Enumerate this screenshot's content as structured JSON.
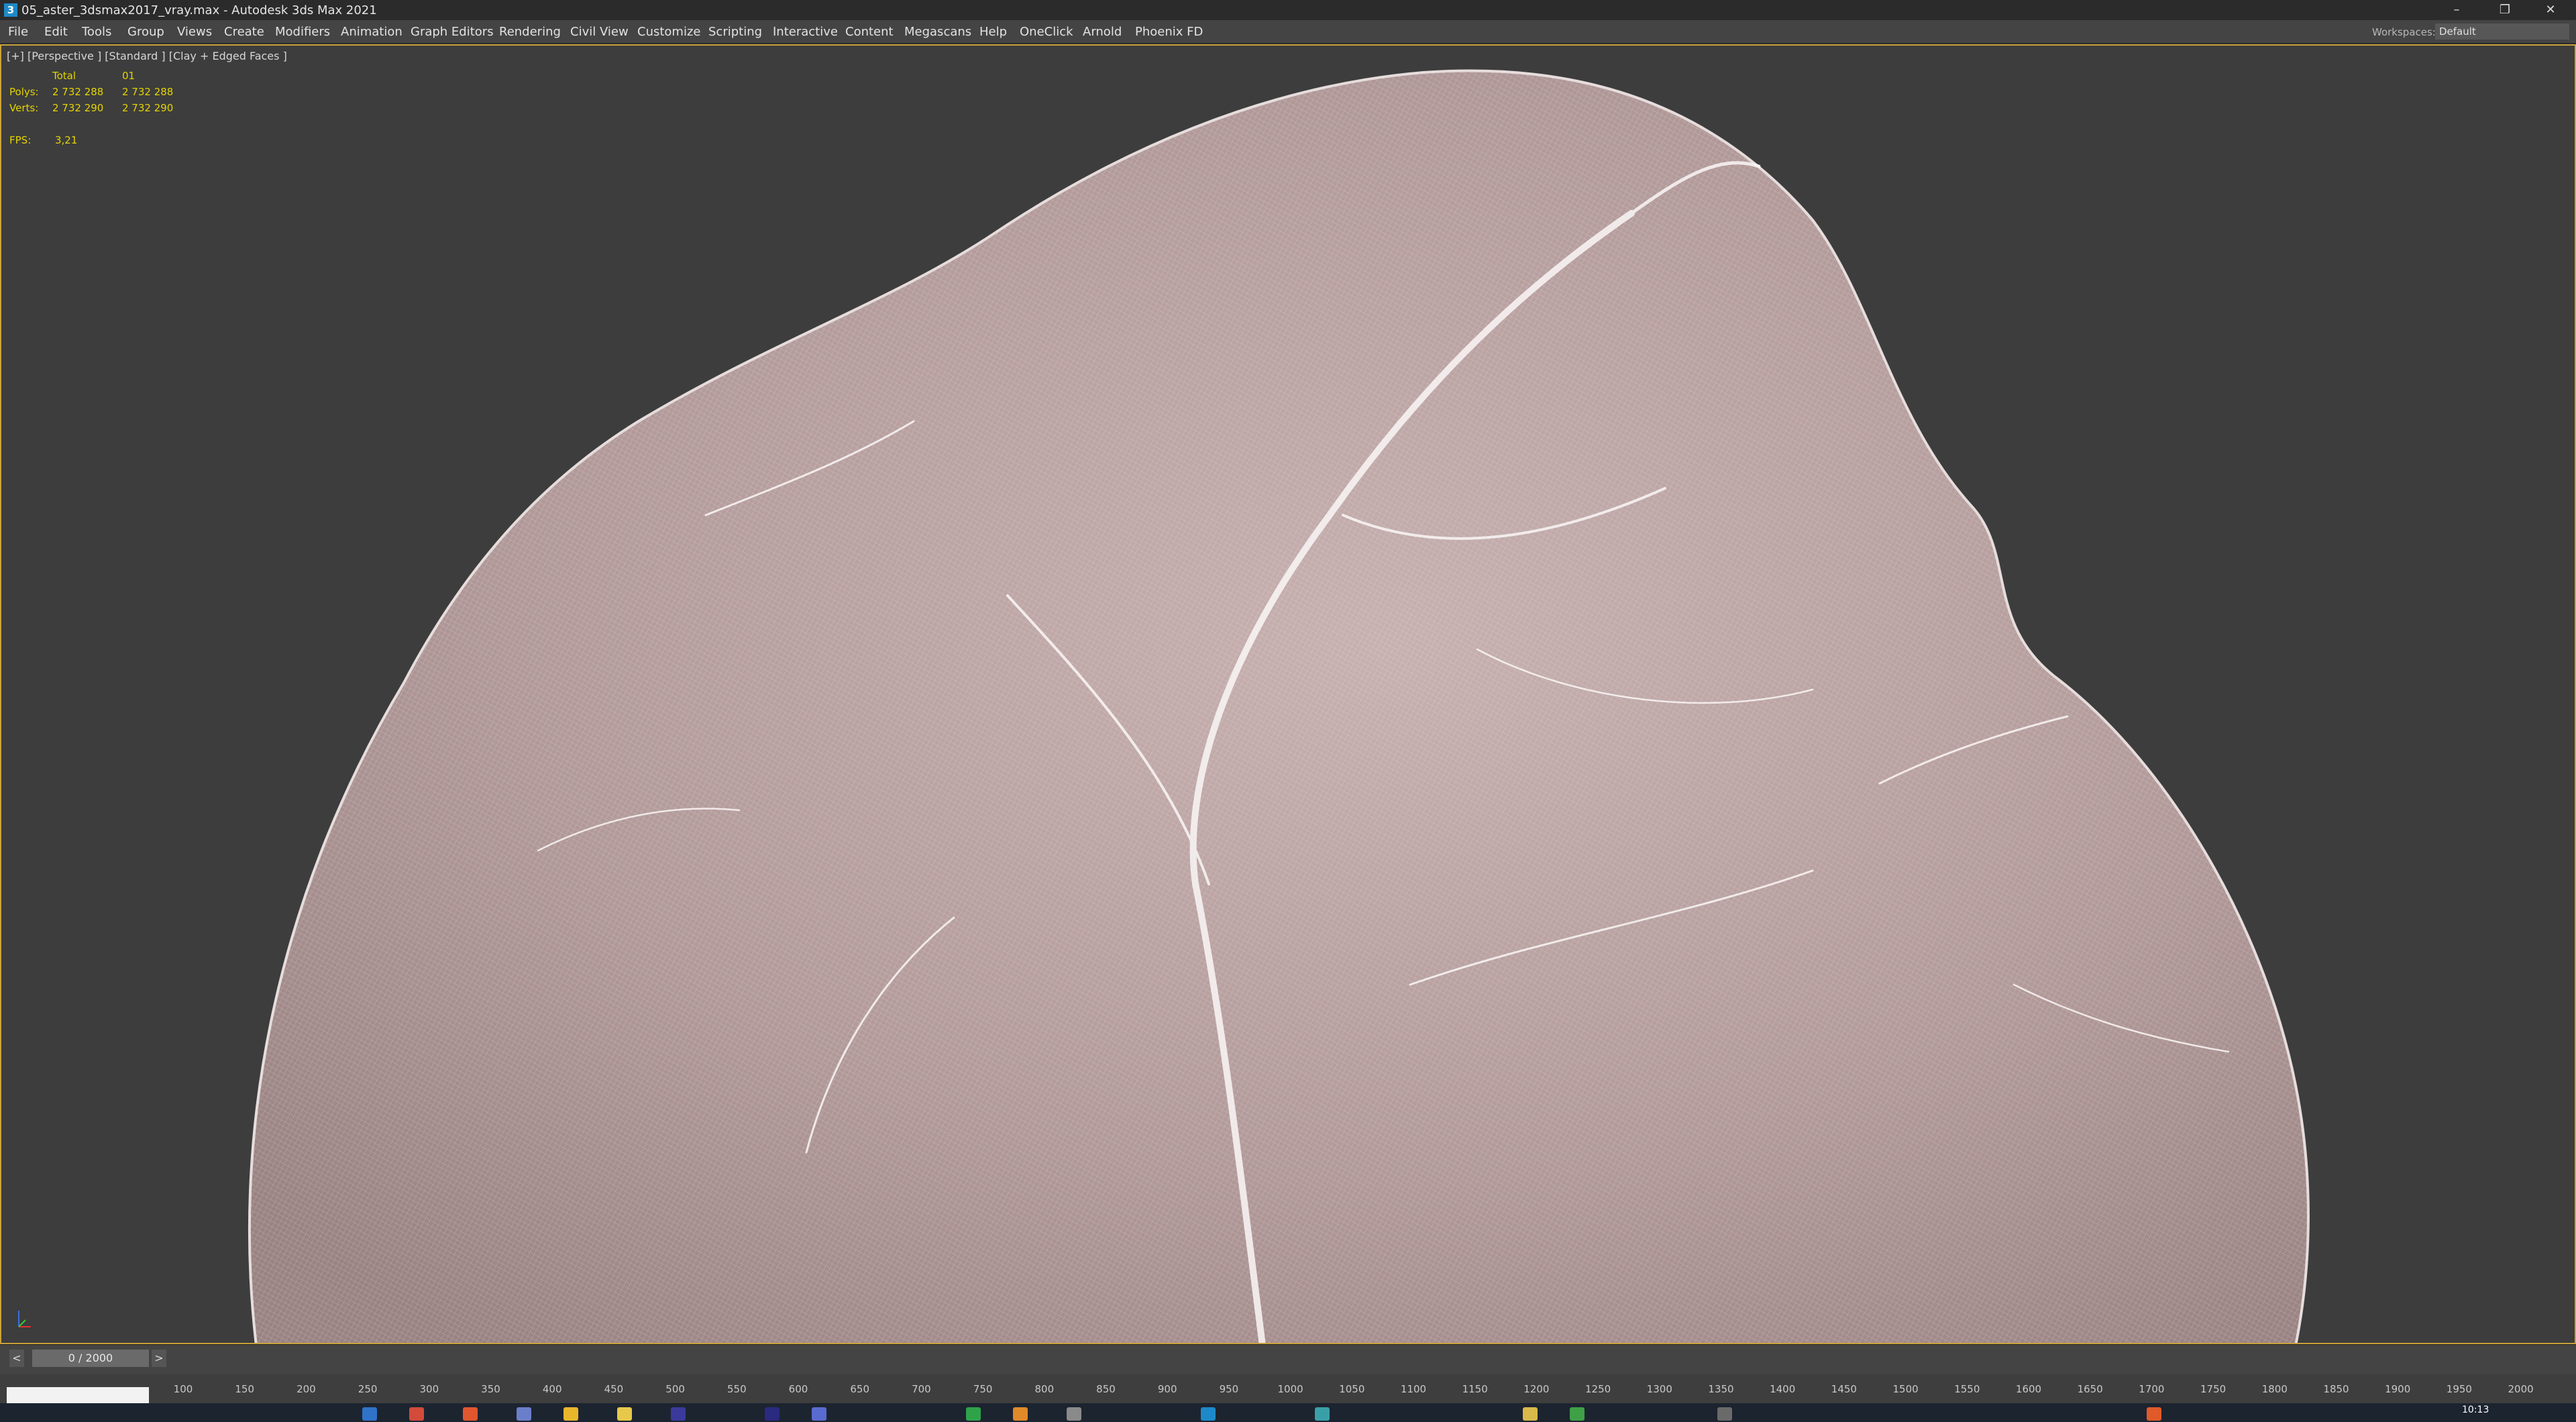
{
  "window": {
    "title": "05_aster_3dsmax2017_vray.max - Autodesk 3ds Max 2021",
    "icon_letter": "3",
    "controls": [
      "–",
      "❐",
      "✕"
    ]
  },
  "menu": {
    "items": [
      "File",
      "Edit",
      "Tools",
      "Group",
      "Views",
      "Create",
      "Modifiers",
      "Animation",
      "Graph Editors",
      "Rendering",
      "Civil View",
      "Customize",
      "Scripting",
      "Interactive",
      "Content",
      "Megascans",
      "Help",
      "OneClick",
      "Arnold",
      "Phoenix FD"
    ],
    "workspaces_label": "Workspaces:",
    "workspaces_value": "Default"
  },
  "viewport": {
    "label": "[+] [Perspective ] [Standard ] [Clay + Edged Faces ]",
    "stats": {
      "total_header": "Total",
      "object_header": "01",
      "polys_label": "Polys:",
      "polys_total": "2 732 288",
      "polys_obj": "2 732 288",
      "verts_label": "Verts:",
      "verts_total": "2 732 290",
      "verts_obj": "2 732 290",
      "fps_label": "FPS:",
      "fps_value": "3,21"
    }
  },
  "timeslider": {
    "prev": "<",
    "next": ">",
    "frame_display": "0 / 2000"
  },
  "ruler": {
    "ticks": [
      "100",
      "150",
      "200",
      "250",
      "300",
      "350",
      "400",
      "450",
      "500",
      "550",
      "600",
      "650",
      "700",
      "750",
      "800",
      "850",
      "900",
      "950",
      "1000",
      "1050",
      "1100",
      "1150",
      "1200",
      "1250",
      "1300",
      "1350",
      "1400",
      "1450",
      "1500",
      "1550",
      "1600",
      "1650",
      "1700",
      "1750",
      "1800",
      "1850",
      "1900",
      "1950",
      "2000"
    ]
  },
  "taskbar": {
    "clock": "10:13"
  },
  "colors": {
    "viewport_border": "#c9a23a",
    "stats_text": "#e3d400",
    "rock_base": "#b9a1a1"
  }
}
